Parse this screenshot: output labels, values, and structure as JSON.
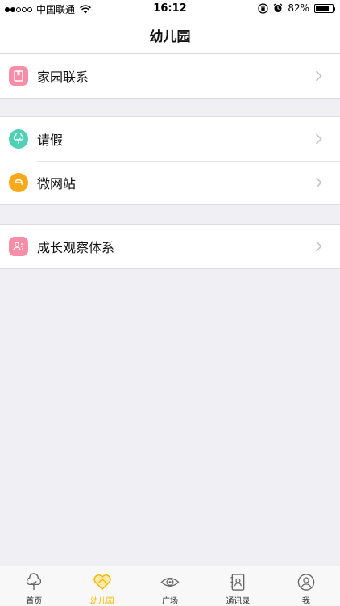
{
  "status_bar": {
    "carrier": "中国联通",
    "time": "16:12",
    "battery_percent": "82%",
    "battery_level": 0.82,
    "icons": [
      "signal-icon",
      "wifi-icon",
      "rotation-lock-icon",
      "alarm-icon",
      "battery-icon"
    ]
  },
  "nav": {
    "title": "幼儿园"
  },
  "groups": [
    {
      "items": [
        {
          "label": "家园联系",
          "icon": "book-icon",
          "color": "#f78da7"
        }
      ]
    },
    {
      "items": [
        {
          "label": "请假",
          "icon": "tree-icon",
          "color": "#4fd1b6"
        },
        {
          "label": "微网站",
          "icon": "e-letter-icon",
          "color": "#f7a81b"
        }
      ]
    },
    {
      "items": [
        {
          "label": "成长观察体系",
          "icon": "person-notes-icon",
          "color": "#f78da7"
        }
      ]
    }
  ],
  "tab_bar": {
    "active": 1,
    "tabs": [
      {
        "label": "首页",
        "icon": "tree-icon"
      },
      {
        "label": "幼儿园",
        "icon": "heart-icon"
      },
      {
        "label": "广场",
        "icon": "eye-icon"
      },
      {
        "label": "通讯录",
        "icon": "contacts-icon"
      },
      {
        "label": "我",
        "icon": "profile-icon"
      }
    ]
  },
  "colors": {
    "accent": "#f5b800",
    "background": "#efeff4"
  }
}
